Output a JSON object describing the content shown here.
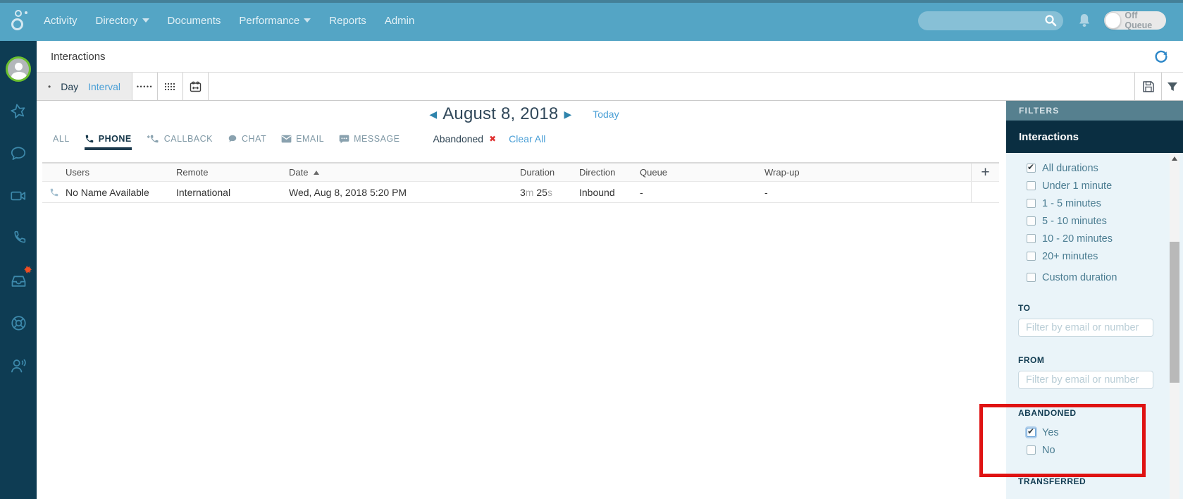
{
  "colors": {
    "topbar": "#54a5c5",
    "sidebar": "#0e3c53",
    "link": "#4a9fd6",
    "filters_header_bg": "#56808f",
    "filters_section_bg": "#0a2e41",
    "panel_bg": "#eaf4f9",
    "annotation_red": "#df1212",
    "badge_orange": "#f04e23",
    "avatar_ring_green": "#6abf2e",
    "active_tab": "#1d3a4d",
    "chip_x_red": "#e03131"
  },
  "topbar": {
    "nav": [
      {
        "label": "Activity"
      },
      {
        "label": "Directory",
        "caret": true
      },
      {
        "label": "Documents"
      },
      {
        "label": "Performance",
        "caret": true
      },
      {
        "label": "Reports"
      },
      {
        "label": "Admin"
      }
    ],
    "search_placeholder": "",
    "off_queue_label": "Off Queue"
  },
  "page": {
    "title": "Interactions"
  },
  "toolbar": {
    "bullet": "•",
    "day_label": "Day",
    "interval_label": "Interval"
  },
  "date_nav": {
    "prev": "◀",
    "date": "August 8, 2018",
    "next": "▶",
    "today": "Today"
  },
  "tabs": [
    {
      "label": "ALL"
    },
    {
      "label": "PHONE",
      "active": true
    },
    {
      "label": "CALLBACK"
    },
    {
      "label": "CHAT"
    },
    {
      "label": "EMAIL"
    },
    {
      "label": "MESSAGE"
    }
  ],
  "applied_filter": {
    "label": "Abandoned",
    "remove": "✖",
    "clear_all": "Clear All"
  },
  "table": {
    "columns": [
      "Users",
      "Remote",
      "Date",
      "Duration",
      "Direction",
      "Queue",
      "Wrap-up"
    ],
    "add_button": "+",
    "rows": [
      {
        "users": "No Name Available",
        "remote": "International",
        "date": "Wed, Aug 8, 2018 5:20 PM",
        "duration": {
          "min": "3",
          "min_unit": "m",
          "sec": " 25",
          "sec_unit": "s"
        },
        "direction": "Inbound",
        "queue": "-",
        "wrapup": "-"
      }
    ]
  },
  "filters": {
    "header": "FILTERS",
    "section": "Interactions",
    "durations": [
      {
        "label": "All durations",
        "checked": true
      },
      {
        "label": "Under 1 minute",
        "checked": false
      },
      {
        "label": "1 - 5 minutes",
        "checked": false
      },
      {
        "label": "5 - 10 minutes",
        "checked": false
      },
      {
        "label": "10 - 20 minutes",
        "checked": false
      },
      {
        "label": "20+ minutes",
        "checked": false
      },
      {
        "label": "Custom duration",
        "checked": false
      }
    ],
    "to": {
      "label": "TO",
      "placeholder": "Filter by email or number",
      "value": ""
    },
    "from": {
      "label": "FROM",
      "placeholder": "Filter by email or number",
      "value": ""
    },
    "abandoned": {
      "label": "ABANDONED",
      "options": [
        {
          "label": "Yes",
          "checked": true
        },
        {
          "label": "No",
          "checked": false
        }
      ]
    },
    "transferred_label": "TRANSFERRED"
  }
}
